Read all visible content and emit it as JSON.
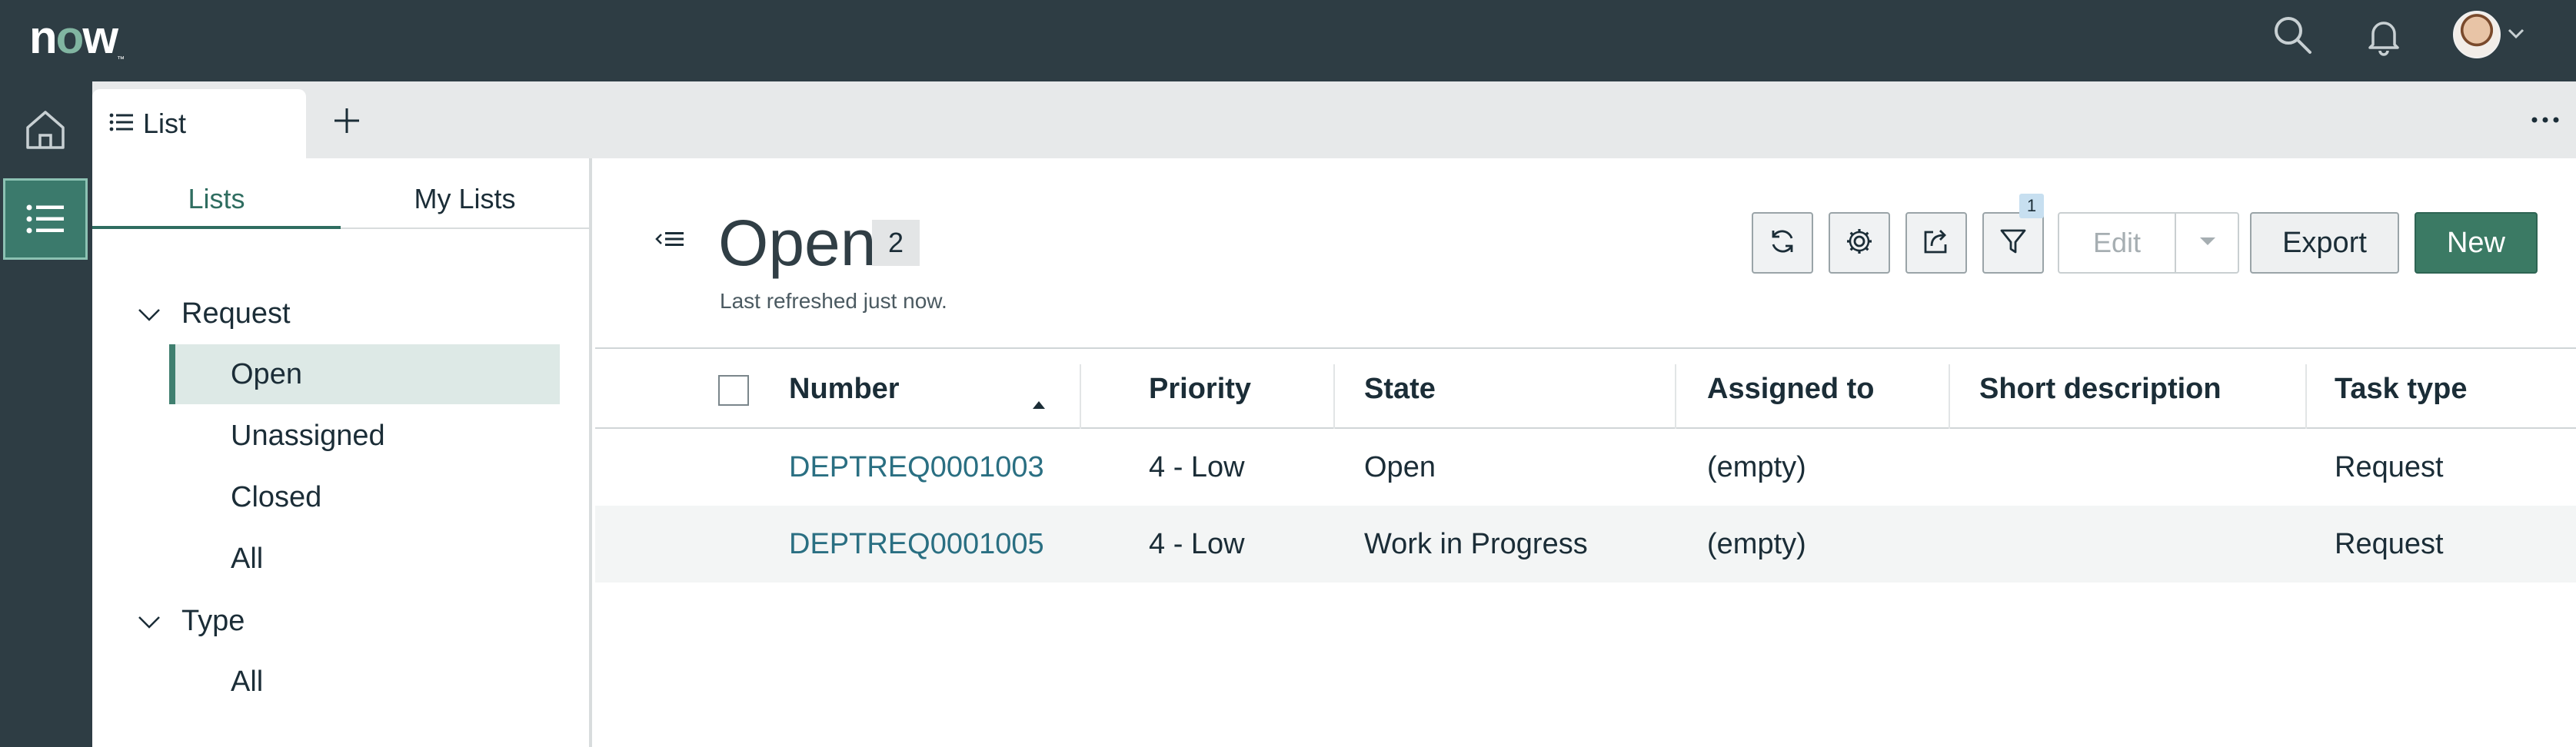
{
  "header": {
    "logo_text_n": "n",
    "logo_text_o": "o",
    "logo_text_w": "w",
    "logo_tm": "™"
  },
  "tabs": [
    {
      "label": "List",
      "icon": "list-icon"
    }
  ],
  "side_panel": {
    "tabs": [
      {
        "label": "Lists",
        "active": true
      },
      {
        "label": "My Lists",
        "active": false
      }
    ],
    "groups": [
      {
        "label": "Request",
        "items": [
          {
            "label": "Open",
            "selected": true
          },
          {
            "label": "Unassigned",
            "selected": false
          },
          {
            "label": "Closed",
            "selected": false
          },
          {
            "label": "All",
            "selected": false
          }
        ]
      },
      {
        "label": "Type",
        "items": [
          {
            "label": "All",
            "selected": false
          }
        ]
      }
    ]
  },
  "main": {
    "title": "Open",
    "count": "2",
    "last_refreshed": "Last refreshed just now.",
    "filter_badge": "1",
    "buttons": {
      "edit": "Edit",
      "export": "Export",
      "new": "New"
    },
    "columns": [
      {
        "label": "Number",
        "sorted": "asc"
      },
      {
        "label": "Priority"
      },
      {
        "label": "State"
      },
      {
        "label": "Assigned to"
      },
      {
        "label": "Short description"
      },
      {
        "label": "Task type"
      }
    ],
    "rows": [
      {
        "number": "DEPTREQ0001003",
        "priority": "4 - Low",
        "state": "Open",
        "assigned_to": "(empty)",
        "short_description": "",
        "task_type": "Request"
      },
      {
        "number": "DEPTREQ0001005",
        "priority": "4 - Low",
        "state": "Work in Progress",
        "assigned_to": "(empty)",
        "short_description": "",
        "task_type": "Request"
      }
    ]
  },
  "colors": {
    "header_bg": "#2e3d44",
    "accent": "#3b7a64",
    "link": "#2a6f82",
    "selected_bg": "#dde9e6"
  }
}
